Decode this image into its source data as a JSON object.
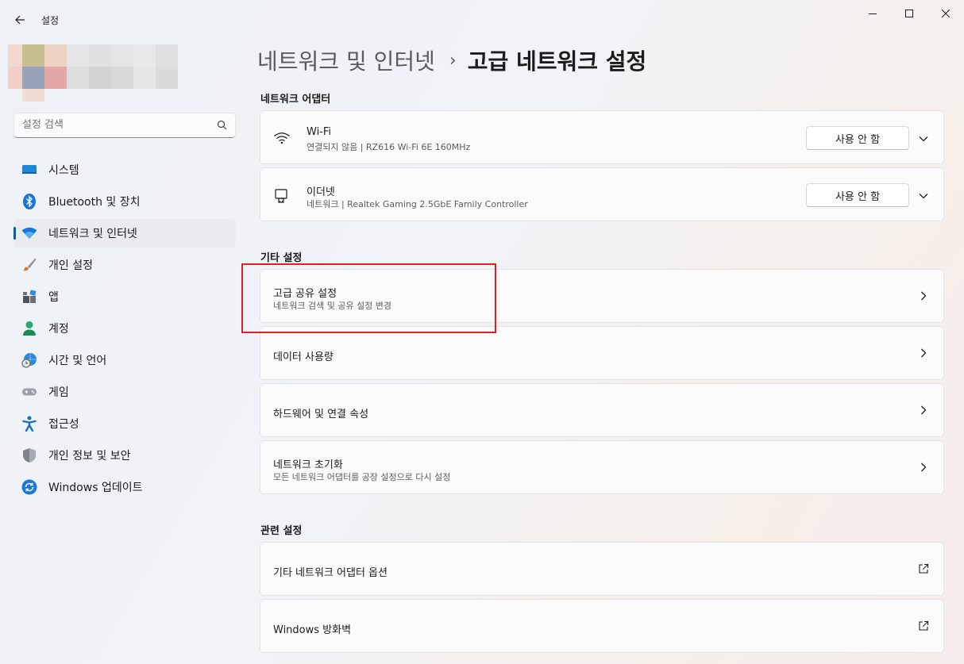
{
  "window": {
    "title": "설정"
  },
  "search": {
    "placeholder": "설정 검색"
  },
  "sidebar": {
    "items": [
      {
        "label": "시스템",
        "icon": "system-icon"
      },
      {
        "label": "Bluetooth 및 장치",
        "icon": "bluetooth-icon"
      },
      {
        "label": "네트워크 및 인터넷",
        "icon": "wifi-icon",
        "active": true
      },
      {
        "label": "개인 설정",
        "icon": "brush-icon"
      },
      {
        "label": "앱",
        "icon": "apps-icon"
      },
      {
        "label": "계정",
        "icon": "account-icon"
      },
      {
        "label": "시간 및 언어",
        "icon": "globe-clock-icon"
      },
      {
        "label": "게임",
        "icon": "gamepad-icon"
      },
      {
        "label": "접근성",
        "icon": "accessibility-icon"
      },
      {
        "label": "개인 정보 및 보안",
        "icon": "shield-icon"
      },
      {
        "label": "Windows 업데이트",
        "icon": "update-icon"
      }
    ]
  },
  "breadcrumb": {
    "parent": "네트워크 및 인터넷",
    "separator": "›",
    "current": "고급 네트워크 설정"
  },
  "adapters": {
    "heading": "네트워크 어댑터",
    "items": [
      {
        "name": "Wi-Fi",
        "desc": "연결되지 않음 | RZ616 Wi-Fi 6E 160MHz",
        "button": "사용 안 함",
        "icon": "wifi-icon"
      },
      {
        "name": "이더넷",
        "desc": "네트워크 | Realtek Gaming 2.5GbE Family Controller",
        "button": "사용 안 함",
        "icon": "ethernet-icon"
      }
    ]
  },
  "other": {
    "heading": "기타 설정",
    "items": [
      {
        "title": "고급 공유 설정",
        "desc": "네트워크 검색 및 공유 설정 변경"
      },
      {
        "title": "데이터 사용량"
      },
      {
        "title": "하드웨어 및 연결 속성"
      },
      {
        "title": "네트워크 초기화",
        "desc": "모든 네트워크 어댑터를 공장 설정으로 다시 설정"
      }
    ]
  },
  "related": {
    "heading": "관련 설정",
    "items": [
      {
        "title": "기타 네트워크 어댑터 옵션"
      },
      {
        "title": "Windows 방화벽"
      }
    ]
  },
  "colors": {
    "accent": "#005fb8",
    "highlight": "#e02020"
  }
}
